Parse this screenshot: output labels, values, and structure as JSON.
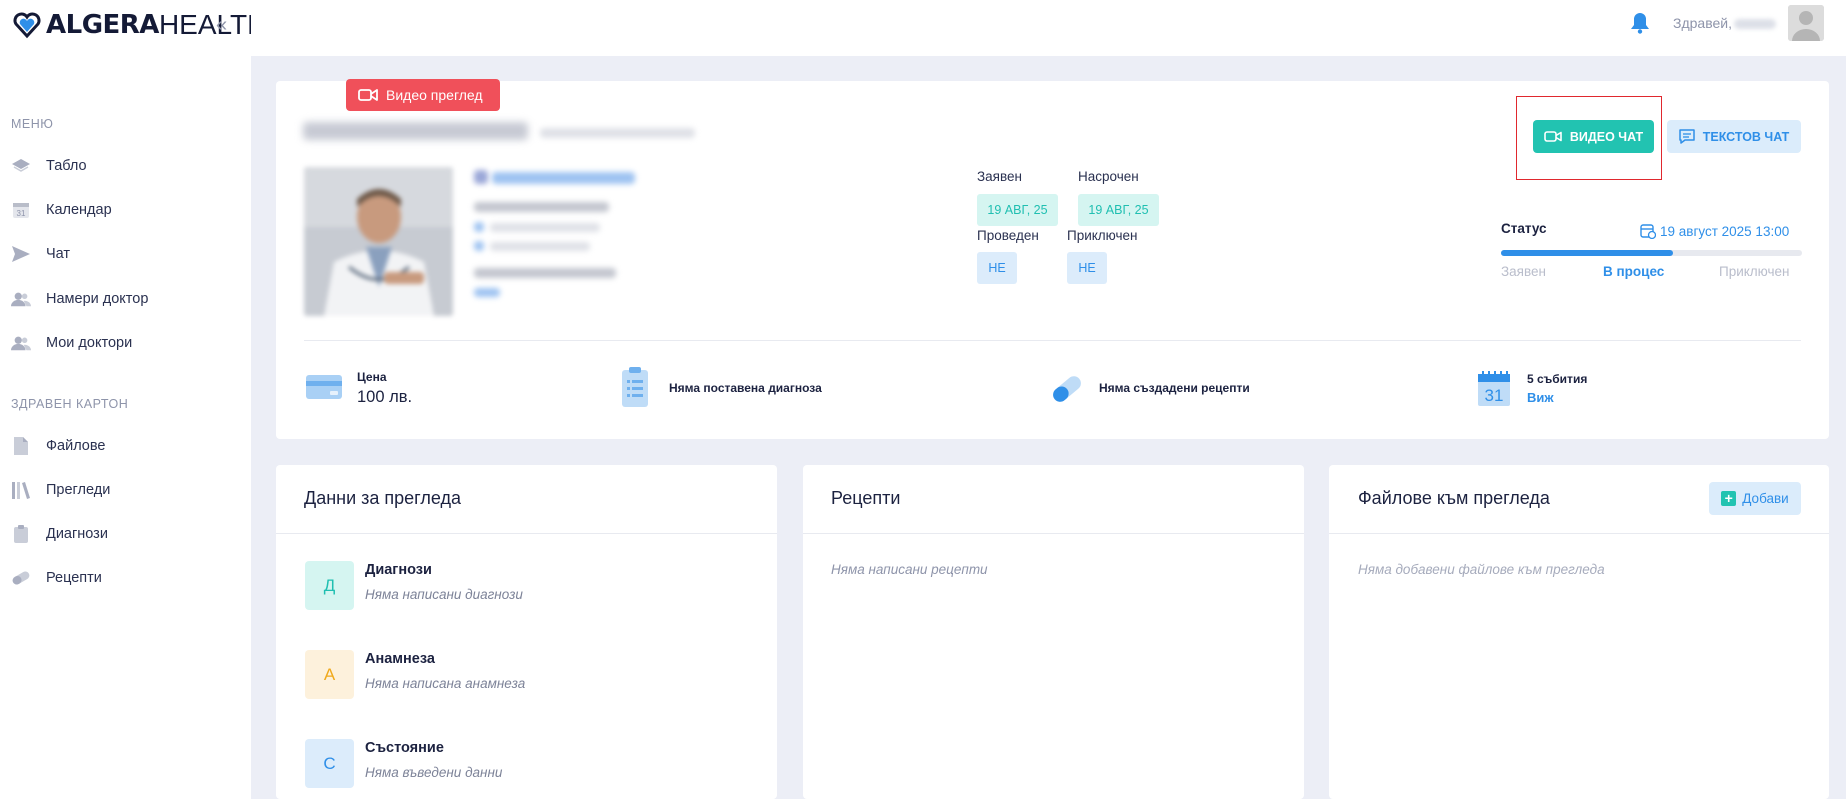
{
  "brand": {
    "name_bold": "ALGERA",
    "name_light": "HEALTH"
  },
  "sidebar": {
    "menu_heading": "МЕНЮ",
    "items": [
      {
        "label": "Табло",
        "icon": "dashboard-icon"
      },
      {
        "label": "Календар",
        "icon": "calendar-icon"
      },
      {
        "label": "Чат",
        "icon": "send-icon"
      },
      {
        "label": "Намери доктор",
        "icon": "users-icon"
      },
      {
        "label": "Мои доктори",
        "icon": "users-icon"
      }
    ],
    "record_heading": "ЗДРАВЕН КАРТОН",
    "record_items": [
      {
        "label": "Файлове",
        "icon": "file-icon"
      },
      {
        "label": "Прегледи",
        "icon": "books-icon"
      },
      {
        "label": "Диагнози",
        "icon": "clipboard-icon"
      },
      {
        "label": "Рецепти",
        "icon": "pill-icon"
      }
    ]
  },
  "topbar": {
    "greeting": "Здравей,"
  },
  "consultation": {
    "type_badge": "Видео преглед",
    "dates": {
      "requested_label": "Заявен",
      "requested_value": "19 АВГ, 25",
      "scheduled_label": "Насрочен",
      "scheduled_value": "19 АВГ, 25",
      "held_label": "Проведен",
      "held_value": "НЕ",
      "completed_label": "Приключен",
      "completed_value": "НЕ"
    },
    "buttons": {
      "video_chat": "ВИДЕО ЧАТ",
      "text_chat": "ТЕКСТОВ ЧАТ"
    },
    "status": {
      "label": "Статус",
      "date": "19 август 2025 13:00",
      "progress": 0.57,
      "steps": [
        "Заявен",
        "В процес",
        "Приключен"
      ],
      "active_step": 1
    },
    "info": {
      "price_label": "Цена",
      "price_value": "100 лв.",
      "diagnosis": "Няма поставена диагноза",
      "prescriptions": "Няма създадени рецепти",
      "events_count": "5 събития",
      "events_link": "Виж",
      "calendar_day": "31"
    }
  },
  "panels": {
    "data": {
      "title": "Данни за прегледа",
      "rows": [
        {
          "badge": "Д",
          "title": "Диагнози",
          "subtitle": "Няма написани диагнози",
          "bg": "#d5f5f1",
          "fg": "#1fbfb1"
        },
        {
          "badge": "А",
          "title": "Анамнеза",
          "subtitle": "Няма написана анамнеза",
          "bg": "#fdf1dc",
          "fg": "#f0a91c"
        },
        {
          "badge": "С",
          "title": "Състояние",
          "subtitle": "Няма въведени данни",
          "bg": "#dcecfb",
          "fg": "#2f8fe8"
        }
      ]
    },
    "prescriptions": {
      "title": "Рецепти",
      "empty": "Няма написани рецепти"
    },
    "files": {
      "title": "Файлове към прегледа",
      "add_label": "Добави",
      "empty": "Няма добавени файлове към прегледа"
    }
  },
  "colors": {
    "teal": "#22c3b1",
    "blue": "#2f8fe8",
    "red": "#f0505a",
    "navy": "#141a36"
  }
}
